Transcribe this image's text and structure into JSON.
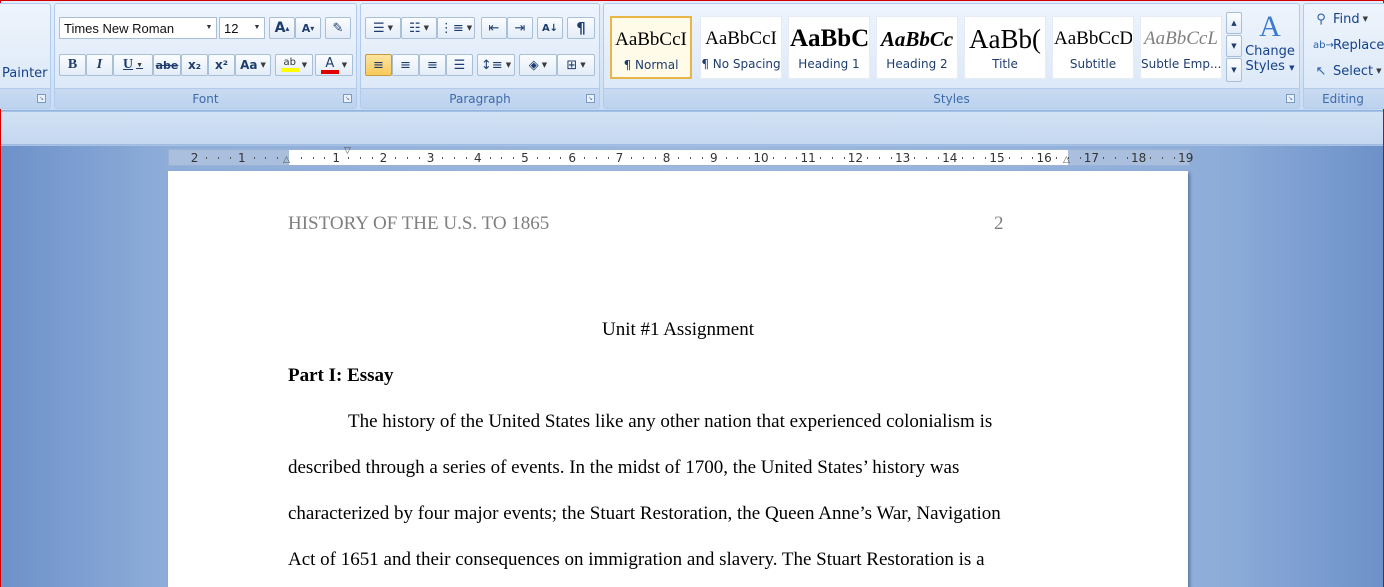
{
  "ribbon": {
    "clipboard": {
      "format_painter_label": "Painter"
    },
    "font": {
      "group_label": "Font",
      "font_name": "Times New Roman",
      "font_size": "12",
      "grow_font": "A",
      "shrink_font": "A",
      "bold": "B",
      "italic": "I",
      "underline": "U",
      "strikethrough": "abe",
      "subscript": "x₂",
      "superscript": "x²",
      "change_case": "Aa",
      "highlight_glyph": "ab",
      "font_color_glyph": "A",
      "highlight_color": "#ffff00",
      "font_color": "#e00000"
    },
    "paragraph": {
      "group_label": "Paragraph",
      "show_marks": "¶"
    },
    "styles": {
      "group_label": "Styles",
      "items": [
        {
          "sample": "AaBbCcI",
          "name": "¶ Normal"
        },
        {
          "sample": "AaBbCcI",
          "name": "¶ No Spacing"
        },
        {
          "sample": "AaBbC",
          "name": "Heading 1"
        },
        {
          "sample": "AaBbCc",
          "name": "Heading 2"
        },
        {
          "sample": "AaBb(",
          "name": "Title"
        },
        {
          "sample": "AaBbCcD",
          "name": "Subtitle"
        },
        {
          "sample": "AaBbCcL",
          "name": "Subtle Emp..."
        }
      ],
      "change_styles_line1": "Change",
      "change_styles_line2": "Styles"
    },
    "editing": {
      "group_label": "Editing",
      "find": "Find",
      "replace": "Replace",
      "select": "Select"
    }
  },
  "ruler": {
    "left_numbers": [
      "2",
      "1"
    ],
    "right_numbers": [
      "1",
      "2",
      "3",
      "4",
      "5",
      "6",
      "7",
      "8",
      "9",
      "10",
      "11",
      "12",
      "13",
      "14",
      "15",
      "16",
      "17",
      "18",
      "19"
    ]
  },
  "document": {
    "header_left": "HISTORY OF THE U.S. TO 1865",
    "page_number": "2",
    "title": "Unit #1 Assignment",
    "heading": "Part I: Essay",
    "lines": [
      "The history of the United States like any other nation that experienced colonialism is",
      "described through a series of events. In the midst of 1700, the United States’ history was",
      "characterized by four major events; the Stuart Restoration, the Queen Anne’s War, Navigation",
      "Act of 1651 and their consequences on immigration and slavery. The Stuart Restoration is a"
    ]
  }
}
